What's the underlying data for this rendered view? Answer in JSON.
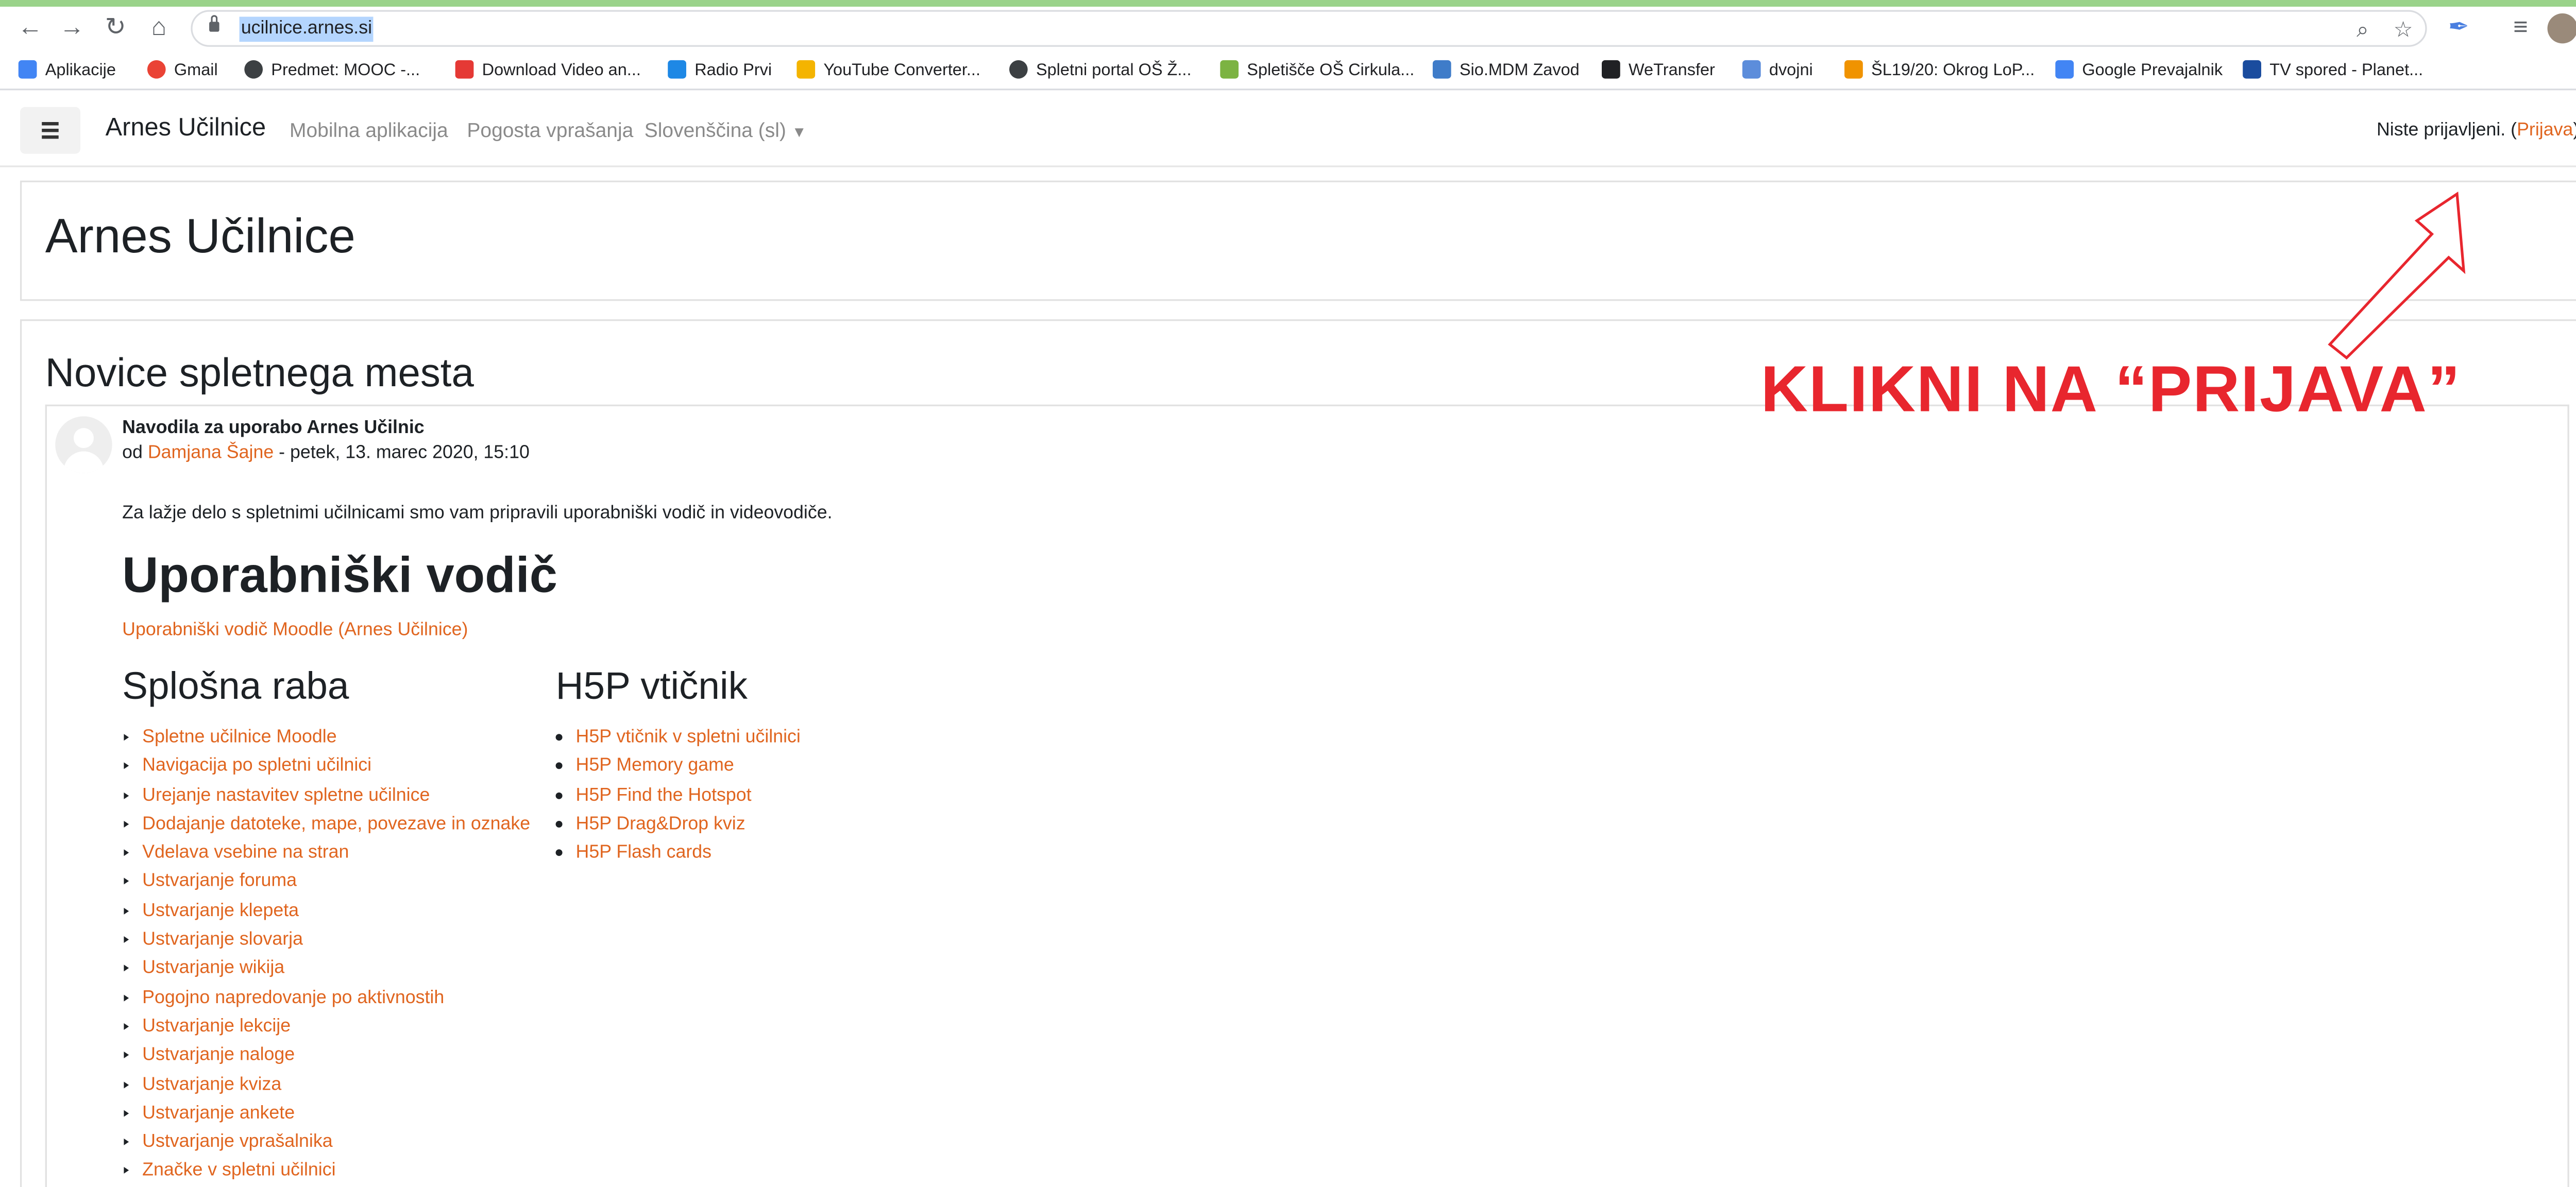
{
  "browser": {
    "url": "ucilnice.arnes.si",
    "bookmarks": [
      {
        "label": "Aplikacije",
        "icon": "apps-grid-icon",
        "color": "#4285f4"
      },
      {
        "label": "Gmail",
        "icon": "google-icon",
        "color": "#ea4335"
      },
      {
        "label": "Predmet: MOOC -...",
        "icon": "globe-icon",
        "color": "#3c4043"
      },
      {
        "label": "Download Video an...",
        "icon": "download-icon",
        "color": "#e53935"
      },
      {
        "label": "Radio Prvi",
        "icon": "radio-icon",
        "color": "#1e88e5"
      },
      {
        "label": "YouTube Converter...",
        "icon": "converter-icon",
        "color": "#f4b400"
      },
      {
        "label": "Spletni portal OŠ Ž...",
        "icon": "globe-icon",
        "color": "#3c4043"
      },
      {
        "label": "Spletišče OŠ Cirkula...",
        "icon": "school-icon",
        "color": "#7cb342"
      },
      {
        "label": "Sio.MDM Zavod",
        "icon": "sio-icon",
        "color": "#3f7cc9"
      },
      {
        "label": "WeTransfer",
        "icon": "wetransfer-icon",
        "color": "#202124"
      },
      {
        "label": "dvojni",
        "icon": "shield-icon",
        "color": "#5c8ddb"
      },
      {
        "label": "ŠL19/20: Okrog LoP...",
        "icon": "star-icon",
        "color": "#f09300"
      },
      {
        "label": "Google Prevajalnik",
        "icon": "translate-icon",
        "color": "#4285f4"
      },
      {
        "label": "TV spored - Planet...",
        "icon": "tv-icon",
        "color": "#1a4c9e"
      }
    ]
  },
  "navbar": {
    "brand": "Arnes Učilnice",
    "links": [
      "Mobilna aplikacija",
      "Pogosta vprašanja",
      "Slovenščina (sl)"
    ],
    "login_text": "Niste prijavljeni. (",
    "login_link": "Prijava",
    "login_close": ")"
  },
  "page": {
    "title": "Arnes Učilnice",
    "news_title": "Novice spletnega mesta",
    "post": {
      "subject": "Navodila za uporabo Arnes Učilnic",
      "by": "od ",
      "author": "Damjana Šajne",
      "date": " - petek, 13. marec 2020, 15:10",
      "intro": "Za lažje delo s spletnimi učilnicami smo vam pripravili uporabniški vodič in videovodiče.",
      "guide_heading": "Uporabniški vodič",
      "guide_link": "Uporabniški vodič Moodle (Arnes Učilnice)",
      "col1_heading": "Splošna raba",
      "col1_items": [
        "Spletne učilnice Moodle",
        "Navigacija po spletni učilnici",
        "Urejanje nastavitev spletne učilnice",
        "Dodajanje datoteke, mape, povezave in oznake",
        "Vdelava vsebine na stran",
        "Ustvarjanje foruma",
        "Ustvarjanje klepeta",
        "Ustvarjanje slovarja",
        "Ustvarjanje wikija",
        "Pogojno napredovanje po aktivnostih",
        "Ustvarjanje lekcije",
        "Ustvarjanje naloge",
        "Ustvarjanje kviza",
        "Ustvarjanje ankete",
        "Ustvarjanje vprašalnika",
        "Značke v spletni učilnici"
      ],
      "col2_heading": "H5P vtičnik",
      "col2_items": [
        "H5P vtičnik v spletni učilnici",
        "H5P Memory game",
        "H5P Find the Hotspot",
        "H5P Drag&Drop kviz",
        "H5P Flash cards"
      ]
    }
  },
  "annotation": {
    "text": "KLIKNI NA “PRIJAVA”",
    "color": "#e8262e"
  },
  "colors": {
    "accent": "#e0651f",
    "text": "#1d2125"
  }
}
